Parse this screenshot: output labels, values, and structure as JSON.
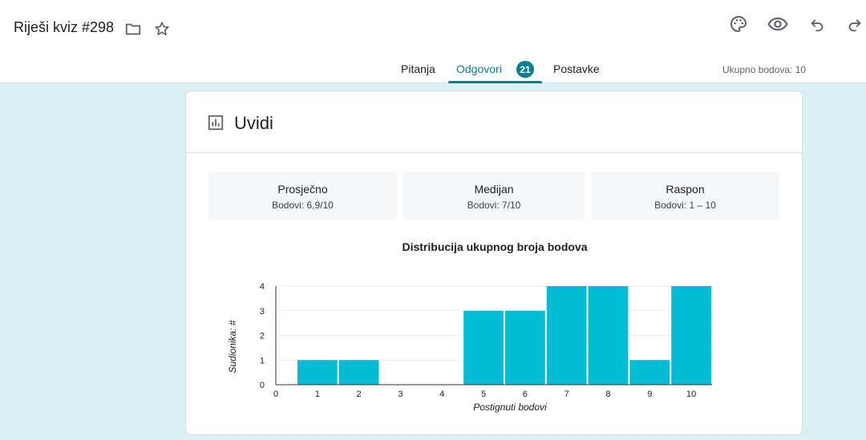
{
  "header": {
    "title": "Riješi kviz #298",
    "icons": [
      "folder-icon",
      "star-icon",
      "palette-icon",
      "preview-eye-icon",
      "undo-icon",
      "redo-icon"
    ]
  },
  "tabs": [
    {
      "label": "Pitanja",
      "active": false
    },
    {
      "label": "Odgovori",
      "active": true,
      "badge": "21"
    },
    {
      "label": "Postavke",
      "active": false
    }
  ],
  "total_points": "Ukupno bodova: 10",
  "insights": {
    "title": "Uvidi",
    "stats": [
      {
        "title": "Prosječno",
        "value": "Bodovi: 6,9/10"
      },
      {
        "title": "Medijan",
        "value": "Bodovi: 7/10"
      },
      {
        "title": "Raspon",
        "value": "Bodovi: 1 – 10"
      }
    ]
  },
  "colors": {
    "accent": "#0b7f8f",
    "bar": "#00bcd4",
    "background": "#d9f1f5"
  },
  "chart_data": {
    "type": "bar",
    "title": "Distribucija ukupnog broja bodova",
    "xlabel": "Postignuti bodovi",
    "ylabel": "Sudionika: #",
    "x": [
      1,
      2,
      3,
      4,
      5,
      6,
      7,
      8,
      9,
      10
    ],
    "values": [
      1,
      1,
      0,
      0,
      3,
      3,
      4,
      4,
      1,
      4
    ],
    "x_ticks": [
      "0",
      "1",
      "2",
      "3",
      "4",
      "5",
      "6",
      "7",
      "8",
      "9",
      "10"
    ],
    "y_ticks": [
      "0",
      "1",
      "2",
      "3",
      "4"
    ],
    "xlim": [
      0,
      10.5
    ],
    "ylim": [
      0,
      4
    ],
    "grid": true
  }
}
